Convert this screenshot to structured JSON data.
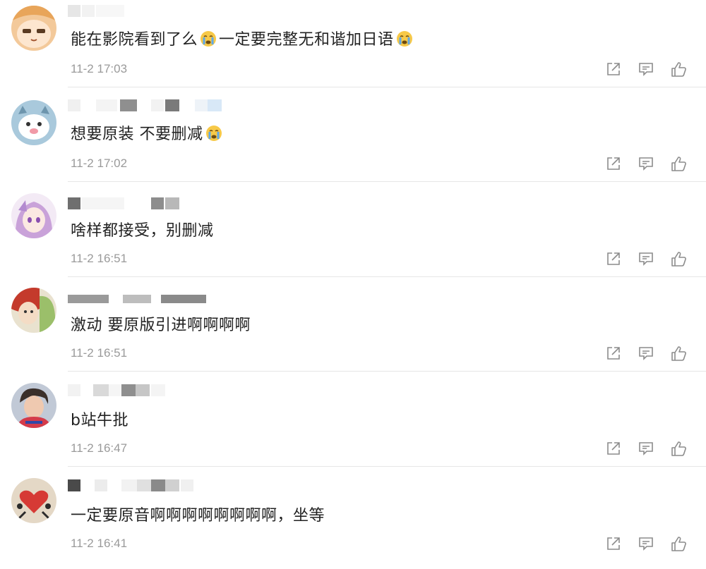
{
  "comments": [
    {
      "text_before": "能在影院看到了么",
      "text_after": "一定要完整无和谐加日语",
      "time": "11-2 17:03",
      "avatar": "cartoon-girl-avatar"
    },
    {
      "text_before": "想要原装 不要删减",
      "time": "11-2 17:02",
      "avatar": "cartoon-animal-avatar"
    },
    {
      "text_before": "啥样都接受，别删减",
      "time": "11-2 16:51",
      "avatar": "anime-girl-avatar"
    },
    {
      "text_before": "激动 要原版引进啊啊啊啊",
      "time": "11-2 16:51",
      "avatar": "illustration-avatar"
    },
    {
      "text_before": "b站牛批",
      "time": "11-2 16:47",
      "avatar": "photo-person-avatar"
    },
    {
      "text_before": "一定要原音啊啊啊啊啊啊啊啊，坐等",
      "time": "11-2 16:41",
      "avatar": "heart-art-avatar"
    }
  ],
  "icons": {
    "share": "share-icon",
    "reply": "comment-icon",
    "like": "thumbs-up-icon",
    "emoji": "crying-face-emoji"
  },
  "colors": {
    "text": "#222222",
    "time": "#9a9a9a",
    "icon": "#8c8c8c",
    "divider": "#e6e6e6"
  }
}
